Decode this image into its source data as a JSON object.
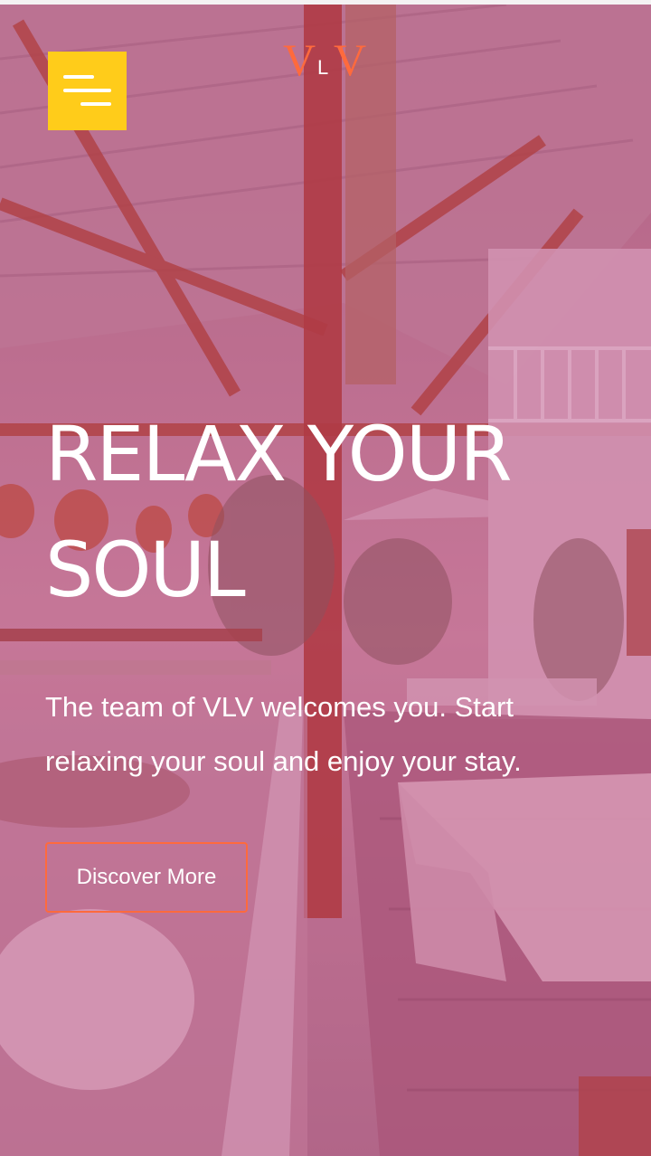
{
  "header": {
    "menu_icon": "hamburger-menu-icon",
    "logo": {
      "letter_left": "V",
      "letter_middle": "L",
      "letter_right": "V"
    }
  },
  "hero": {
    "headline_line1": "RELAX YOUR",
    "headline_line2": "SOUL",
    "subtitle": "The team of VLV welcomes you. Start relaxing your soul and enjoy your stay.",
    "cta_label": "Discover More"
  },
  "colors": {
    "accent_yellow": "#ffcc1a",
    "accent_orange": "#ff6a3d",
    "overlay_tint": "#aa286e",
    "text": "#ffffff"
  }
}
